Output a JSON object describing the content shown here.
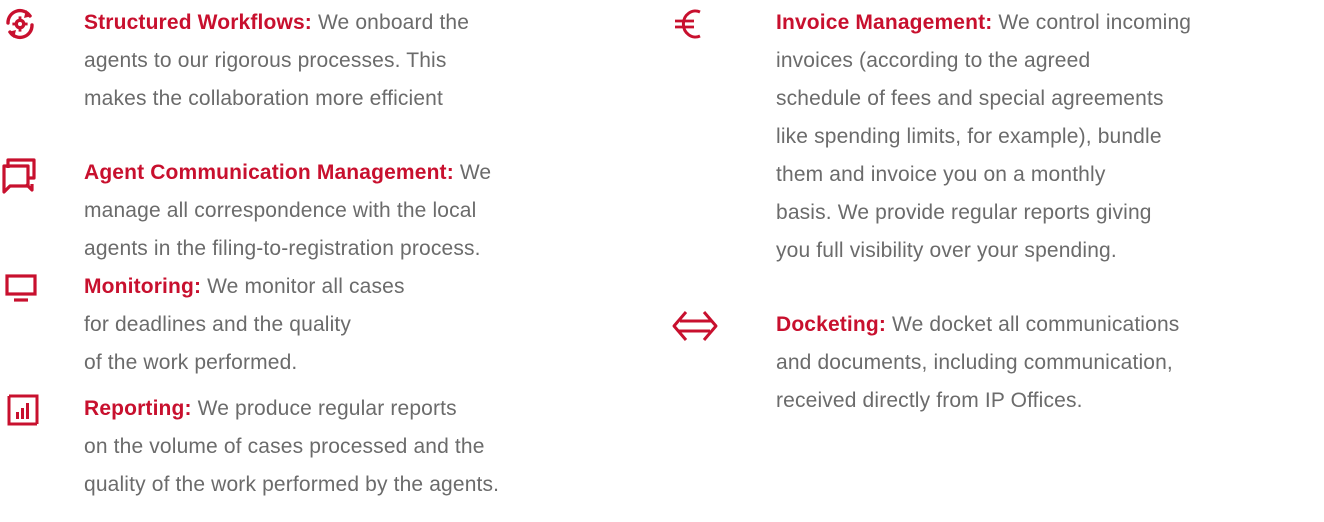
{
  "colors": {
    "accent": "#c8102e",
    "text": "#6b6b6b",
    "background": "#ffffff"
  },
  "left_column": {
    "items": [
      {
        "icon": "refresh-gear-icon",
        "title": "Structured Workflows:",
        "text": " We onboard the\nagents to our rigorous processes. This\nmakes the collaboration more efficient"
      },
      {
        "icon": "chat-bubbles-icon",
        "title": "Agent Communication Management:",
        "text": " We\nmanage all correspondence with the local\nagents in the filing-to-registration process."
      },
      {
        "icon": "monitor-icon",
        "title": "Monitoring:",
        "text": " We monitor all cases\nfor deadlines and the quality\nof the work performed."
      },
      {
        "icon": "bar-chart-icon",
        "title": "Reporting:",
        "text": " We produce regular reports\non the volume of cases processed and the\nquality of the work performed by the agents."
      }
    ]
  },
  "right_column": {
    "items": [
      {
        "icon": "euro-icon",
        "title": "Invoice Management:",
        "text": " We control incoming\ninvoices (according to the agreed\nschedule of fees and special agreements\nlike spending limits, for example), bundle\nthem and invoice you on a monthly\nbasis. We provide regular reports giving\nyou full visibility over your spending."
      },
      {
        "icon": "exchange-arrows-icon",
        "title": "Docketing:",
        "text": " We docket all communications\nand documents, including communication,\nreceived directly from IP Offices."
      }
    ]
  }
}
